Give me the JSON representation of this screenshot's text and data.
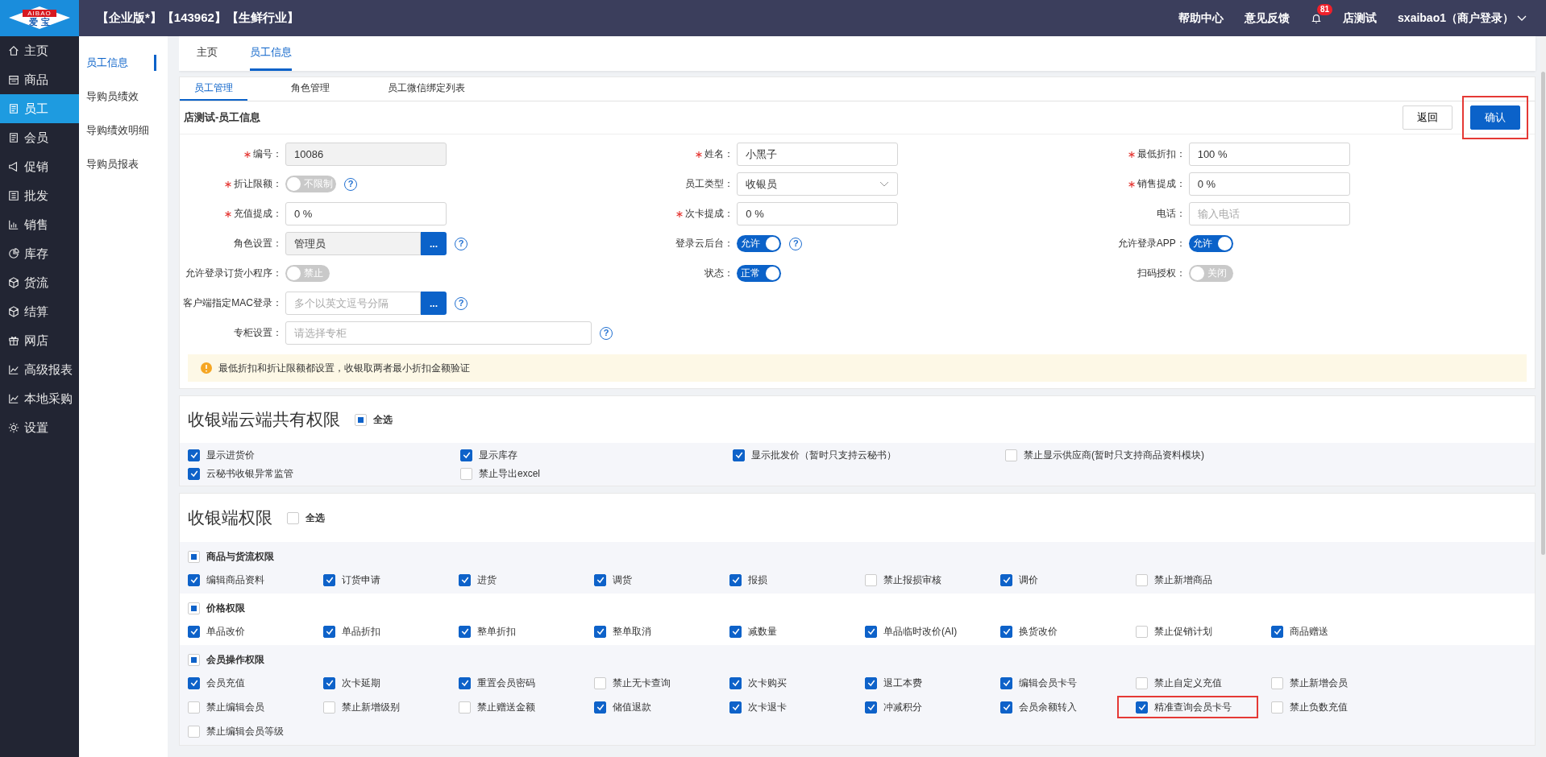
{
  "logo": {
    "top": "AIBAO",
    "bottom": "爱 宝"
  },
  "top_bar": {
    "title": "【企业版*】【143962】【生鲜行业】",
    "links": [
      "帮助中心",
      "意见反馈"
    ],
    "notification_count": "81",
    "store": "店测试",
    "user": "sxaibao1（商户登录）"
  },
  "sidebar": {
    "items": [
      {
        "label": "主页",
        "selected": false
      },
      {
        "label": "商品",
        "selected": false
      },
      {
        "label": "员工",
        "selected": true
      },
      {
        "label": "会员",
        "selected": false
      },
      {
        "label": "促销",
        "selected": false
      },
      {
        "label": "批发",
        "selected": false
      },
      {
        "label": "销售",
        "selected": false
      },
      {
        "label": "库存",
        "selected": false
      },
      {
        "label": "货流",
        "selected": false
      },
      {
        "label": "结算",
        "selected": false
      },
      {
        "label": "网店",
        "selected": false
      },
      {
        "label": "高级报表",
        "selected": false
      },
      {
        "label": "本地采购",
        "selected": false
      },
      {
        "label": "设置",
        "selected": false
      }
    ]
  },
  "sub_nav": {
    "items": [
      {
        "label": "员工信息",
        "selected": true
      },
      {
        "label": "导购员绩效",
        "selected": false
      },
      {
        "label": "导购绩效明细",
        "selected": false
      },
      {
        "label": "导购员报表",
        "selected": false
      }
    ]
  },
  "page_tabs": [
    {
      "label": "主页",
      "selected": false
    },
    {
      "label": "员工信息",
      "selected": true
    }
  ],
  "sub_tabs": [
    {
      "label": "员工管理",
      "selected": true
    },
    {
      "label": "角色管理",
      "selected": false
    },
    {
      "label": "员工微信绑定列表",
      "selected": false
    }
  ],
  "card": {
    "title": "店测试-员工信息",
    "buttons": [
      {
        "label": "返回",
        "kind": "secondary",
        "highlighted": false
      },
      {
        "label": "确认",
        "kind": "primary",
        "highlighted": true
      }
    ]
  },
  "form": {
    "rows": [
      [
        {
          "label": "编号：",
          "required": true,
          "kind": "readonly",
          "value": "10086"
        },
        {
          "label": "姓名：",
          "required": true,
          "kind": "text",
          "value": "小黑子"
        },
        {
          "label": "最低折扣：",
          "required": true,
          "kind": "text",
          "value": "100 %"
        }
      ],
      [
        {
          "label": "折让限额：",
          "required": true,
          "kind": "toggle",
          "on": false,
          "text": "不限制",
          "help": "?"
        },
        {
          "label": "员工类型：",
          "required": false,
          "kind": "select",
          "value": "收银员"
        },
        {
          "label": "销售提成：",
          "required": true,
          "kind": "text",
          "value": "0 %"
        }
      ],
      [
        {
          "label": "充值提成：",
          "required": true,
          "kind": "text",
          "value": "0 %"
        },
        {
          "label": "次卡提成：",
          "required": true,
          "kind": "text",
          "value": "0 %"
        },
        {
          "label": "电话：",
          "required": false,
          "kind": "text",
          "placeholder": "输入电话"
        }
      ],
      [
        {
          "label": "角色设置：",
          "required": false,
          "kind": "picker",
          "value": "管理员",
          "button": "...",
          "help": "?"
        },
        {
          "label": "登录云后台：",
          "required": false,
          "kind": "toggle",
          "on": true,
          "text": "允许",
          "help": "?"
        },
        {
          "label": "允许登录APP：",
          "required": false,
          "kind": "toggle",
          "on": true,
          "text": "允许"
        }
      ],
      [
        {
          "label": "允许登录订货小程序：",
          "required": false,
          "kind": "toggle",
          "on": false,
          "text": "禁止"
        },
        {
          "label": "状态：",
          "required": false,
          "kind": "toggle",
          "on": true,
          "text": "正常"
        },
        {
          "label": "扫码授权：",
          "required": false,
          "kind": "toggle",
          "on": false,
          "text": "关闭"
        }
      ],
      [
        {
          "label": "客户端指定MAC登录：",
          "required": false,
          "kind": "picker",
          "placeholder": "多个以英文逗号分隔",
          "button": "...",
          "help": "?"
        }
      ],
      [
        {
          "label": "专柜设置：",
          "required": false,
          "kind": "text",
          "placeholder": "请选择专柜",
          "help": "?"
        }
      ]
    ],
    "notice": "最低折扣和折让限额都设置，收银取两者最小折扣金额验证"
  },
  "shared_permissions": {
    "title": "收银端云端共有权限",
    "select_all": {
      "label": "全选",
      "partial": true
    },
    "items": [
      {
        "label": "显示进货价",
        "checked": true
      },
      {
        "label": "显示库存",
        "checked": true
      },
      {
        "label": "显示批发价（暂时只支持云秘书）",
        "checked": true
      },
      {
        "label": "禁止显示供应商(暂时只支持商品资料模块)",
        "checked": false
      },
      {
        "label": "云秘书收银异常监管",
        "checked": true
      },
      {
        "label": "禁止导出excel",
        "checked": false
      }
    ]
  },
  "cashier_permissions": {
    "title": "收银端权限",
    "select_all": {
      "label": "全选",
      "partial": false
    },
    "groups": [
      {
        "title": "商品与货流权限",
        "partial": true,
        "items": [
          {
            "label": "编辑商品资料",
            "checked": true
          },
          {
            "label": "订货申请",
            "checked": true
          },
          {
            "label": "进货",
            "checked": true
          },
          {
            "label": "调货",
            "checked": true
          },
          {
            "label": "报损",
            "checked": true
          },
          {
            "label": "禁止报损审核",
            "checked": false
          },
          {
            "label": "调价",
            "checked": true
          },
          {
            "label": "禁止新增商品",
            "checked": false
          }
        ]
      },
      {
        "title": "价格权限",
        "partial": true,
        "items": [
          {
            "label": "单品改价",
            "checked": true
          },
          {
            "label": "单品折扣",
            "checked": true
          },
          {
            "label": "整单折扣",
            "checked": true
          },
          {
            "label": "整单取消",
            "checked": true
          },
          {
            "label": "减数量",
            "checked": true
          },
          {
            "label": "单品临时改价(AI)",
            "checked": true
          },
          {
            "label": "换货改价",
            "checked": true
          },
          {
            "label": "禁止促销计划",
            "checked": false
          },
          {
            "label": "商品赠送",
            "checked": true
          }
        ]
      },
      {
        "title": "会员操作权限",
        "partial": true,
        "items": [
          {
            "label": "会员充值",
            "checked": true
          },
          {
            "label": "次卡延期",
            "checked": true
          },
          {
            "label": "重置会员密码",
            "checked": true
          },
          {
            "label": "禁止无卡查询",
            "checked": false
          },
          {
            "label": "次卡购买",
            "checked": true
          },
          {
            "label": "退工本费",
            "checked": true
          },
          {
            "label": "编辑会员卡号",
            "checked": true
          },
          {
            "label": "禁止自定义充值",
            "checked": false
          },
          {
            "label": "禁止新增会员",
            "checked": false
          },
          {
            "label": "禁止编辑会员",
            "checked": false
          },
          {
            "label": "禁止新增级别",
            "checked": false
          },
          {
            "label": "禁止赠送金额",
            "checked": false
          },
          {
            "label": "储值退款",
            "checked": true
          },
          {
            "label": "次卡退卡",
            "checked": true
          },
          {
            "label": "冲减积分",
            "checked": true
          },
          {
            "label": "会员余额转入",
            "checked": true
          },
          {
            "label": "精准查询会员卡号",
            "checked": true,
            "highlighted": true
          },
          {
            "label": "禁止负数充值",
            "checked": false
          },
          {
            "label": "禁止编辑会员等级",
            "checked": false
          }
        ]
      }
    ]
  }
}
